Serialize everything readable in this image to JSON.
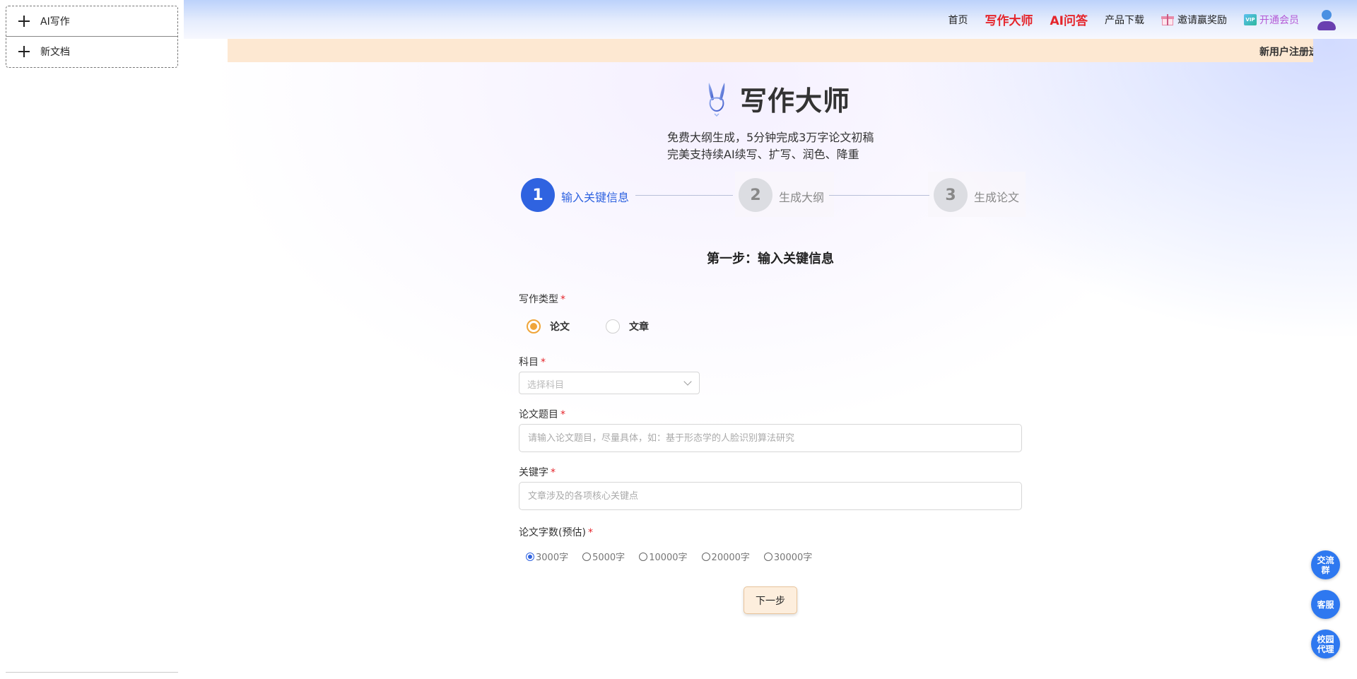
{
  "sidebar": {
    "items": [
      {
        "label": "AI写作"
      },
      {
        "label": "新文档"
      }
    ]
  },
  "header": {
    "nav": {
      "home": "首页",
      "writing_master": "写作大师",
      "ai_qa": "AI问答",
      "download": "产品下载",
      "invite": "邀请赢奖励",
      "vip": "开通会员"
    },
    "notice": "新用户注册送",
    "colors": {
      "accent_red": "#e5252b",
      "vip_purple": "#b55ad6"
    }
  },
  "hero": {
    "title": "写作大师",
    "slogan_line1": "免费大纲生成，5分钟完成3万字论文初稿",
    "slogan_line2": "完美支持续AI续写、扩写、润色、降重"
  },
  "stepper": {
    "steps": [
      {
        "number": "1",
        "label": "输入关键信息",
        "state": "active"
      },
      {
        "number": "2",
        "label": "生成大纲",
        "state": "pending"
      },
      {
        "number": "3",
        "label": "生成论文",
        "state": "pending"
      }
    ],
    "active_color": "#2f63e0"
  },
  "form": {
    "title": "第一步：输入关键信息",
    "required_mark": "*",
    "writing_type": {
      "label": "写作类型",
      "options": [
        "论文",
        "文章"
      ],
      "selected": "论文"
    },
    "subject": {
      "label": "科目",
      "placeholder": "选择科目"
    },
    "topic": {
      "label": "论文题目",
      "placeholder": "请输入论文题目，尽量具体，如：基于形态学的人脸识别算法研究"
    },
    "keywords": {
      "label": "关键字",
      "placeholder": "文章涉及的各项核心关键点"
    },
    "word_count": {
      "label": "论文字数(预估)",
      "options": [
        "3000字",
        "5000字",
        "10000字",
        "20000字",
        "30000字"
      ],
      "selected": "3000字"
    },
    "next_button": "下一步"
  },
  "floating": {
    "group": "交流群",
    "service": "客服",
    "campus": "校园代理"
  }
}
